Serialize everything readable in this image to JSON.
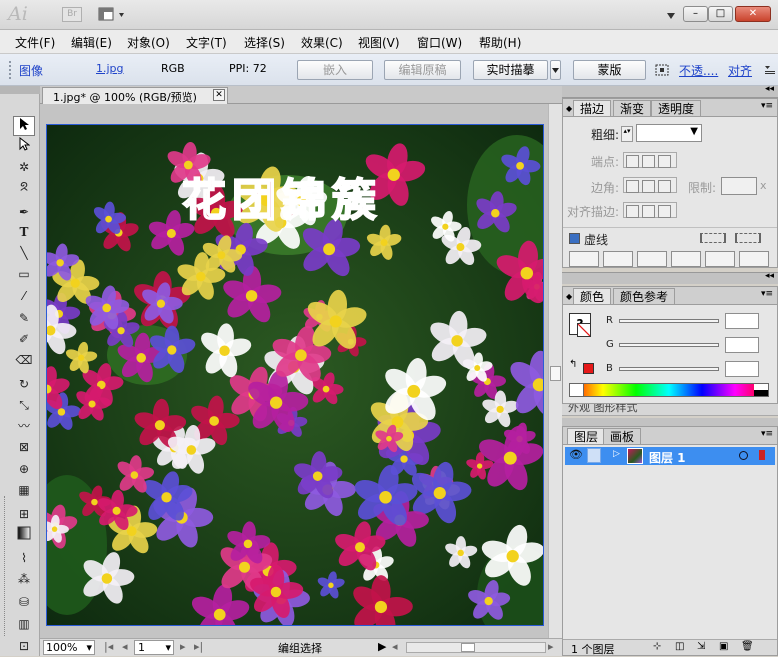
{
  "app": {
    "logo": "Ai",
    "bridge_label": "Br"
  },
  "window_buttons": {
    "minimize": "–",
    "restore": "□",
    "close": "✕"
  },
  "menu": [
    "文件(F)",
    "编辑(E)",
    "对象(O)",
    "文字(T)",
    "选择(S)",
    "效果(C)",
    "视图(V)",
    "窗口(W)",
    "帮助(H)"
  ],
  "control_bar": {
    "object_type": "图像",
    "file_link": "1.jpg",
    "color_mode": "RGB",
    "ppi": "PPI: 72",
    "embed_button": "嵌入",
    "edit_original_button": "编辑原稿",
    "live_trace_button": "实时描摹",
    "mask_button": "蒙版",
    "opacity_link": "不透....",
    "align_link": "对齐"
  },
  "document": {
    "tab_title": "1.jpg* @ 100% (RGB/预览)",
    "image_title_text": "花团锦簇"
  },
  "statusbar": {
    "zoom": "100%",
    "page": "1",
    "status_text": "编组选择"
  },
  "stroke_panel": {
    "tabs": [
      "描边",
      "渐变",
      "透明度"
    ],
    "weight_label": "粗细:",
    "cap_label": "端点:",
    "corner_label": "边角:",
    "limit_label": "限制:",
    "limit_suffix": "x",
    "align_label": "对齐描边:",
    "dashed_label": "虚线"
  },
  "color_panel": {
    "tabs": [
      "颜色",
      "颜色参考"
    ],
    "channels": [
      "R",
      "G",
      "B"
    ],
    "hidden_tabs": "外观  图形样式"
  },
  "layers_panel": {
    "tabs": [
      "图层",
      "画板"
    ],
    "layer_name": "图层 1",
    "layer_count": "1 个图层"
  },
  "colors": {
    "accent": "#2f63d8",
    "layer_highlight": "#3d8ef0",
    "fill_red": "#e51919"
  }
}
